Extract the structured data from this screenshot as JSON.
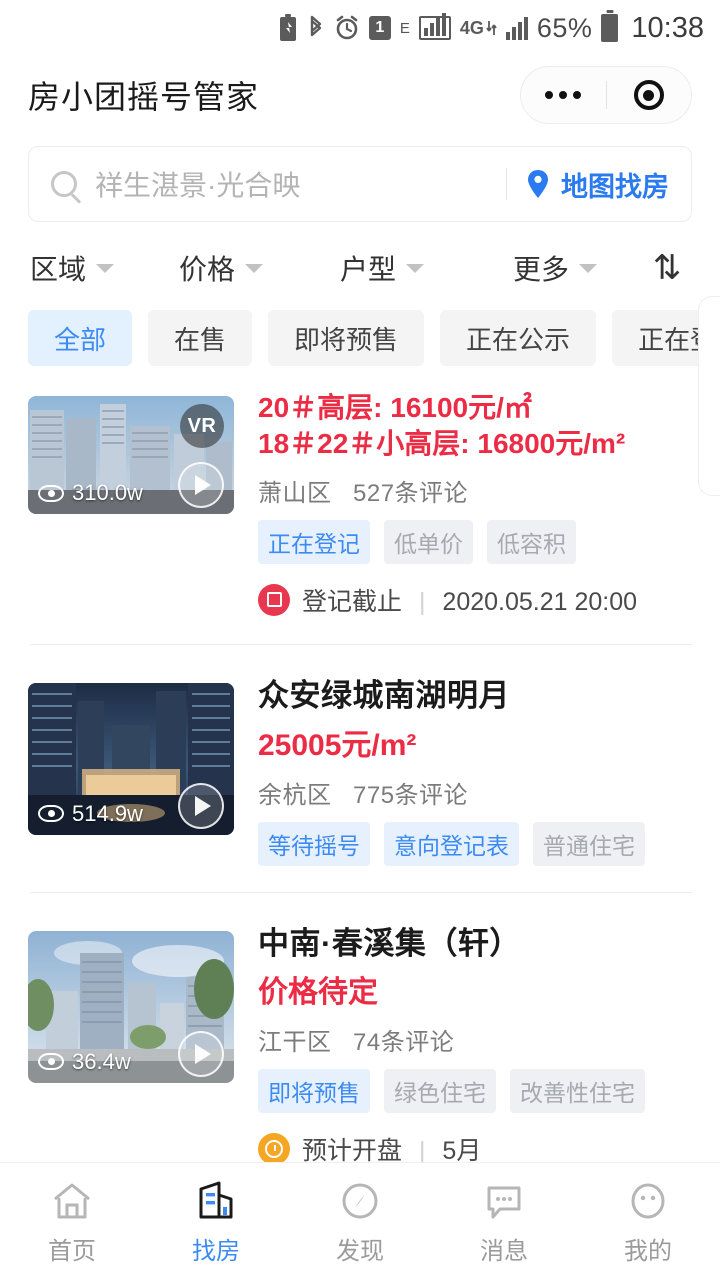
{
  "statusbar": {
    "icons": [
      "battery-saver-icon",
      "bluetooth-icon",
      "alarm-icon",
      "sim1-icon",
      "e-network-icon",
      "signal-boxed-icon",
      "4g-icon",
      "signal-icon"
    ],
    "e_label": "E",
    "sim_label": "1",
    "network_4g": "4G",
    "battery_percent": "65%",
    "clock": "10:38"
  },
  "header": {
    "title": "房小团摇号管家",
    "capsule": {
      "more_label": "•••",
      "target_label": ""
    }
  },
  "search": {
    "placeholder": "祥生湛景·光合映",
    "map_link": "地图找房"
  },
  "filters": [
    {
      "label": "区域"
    },
    {
      "label": "价格"
    },
    {
      "label": "户型"
    },
    {
      "label": "更多"
    }
  ],
  "sort": {
    "icon": "sort-updown-icon",
    "label": "⇅"
  },
  "chips": [
    {
      "label": "全部",
      "active": true
    },
    {
      "label": "在售",
      "active": false
    },
    {
      "label": "即将预售",
      "active": false
    },
    {
      "label": "正在公示",
      "active": false
    },
    {
      "label": "正在登记",
      "active": false
    }
  ],
  "listings": [
    {
      "name": "",
      "price_lines": [
        "20＃高层: 16100元/㎡",
        "18＃22＃小高层: 16800元/m²"
      ],
      "district": "萧山区",
      "comments": "527条评论",
      "tags": [
        {
          "label": "正在登记",
          "style": "blue"
        },
        {
          "label": "低单价",
          "style": "gray"
        },
        {
          "label": "低容积",
          "style": "gray"
        }
      ],
      "note": {
        "badge": "registration-deadline-icon",
        "badge_color": "#e8384f",
        "label": "登记截止",
        "value": "2020.05.21 20:00"
      },
      "views": "310.0w",
      "has_vr": true,
      "vr_label": "VR"
    },
    {
      "name": "众安绿城南湖明月",
      "price_lines": [
        "25005元/m²"
      ],
      "district": "余杭区",
      "comments": "775条评论",
      "tags": [
        {
          "label": "等待摇号",
          "style": "blue"
        },
        {
          "label": "意向登记表",
          "style": "blue"
        },
        {
          "label": "普通住宅",
          "style": "gray"
        }
      ],
      "note": null,
      "views": "514.9w",
      "has_vr": false,
      "vr_label": ""
    },
    {
      "name": "中南·春溪集（轩）",
      "price_lines": [
        "价格待定"
      ],
      "district": "江干区",
      "comments": "74条评论",
      "tags": [
        {
          "label": "即将预售",
          "style": "blue"
        },
        {
          "label": "绿色住宅",
          "style": "gray"
        },
        {
          "label": "改善性住宅",
          "style": "gray"
        }
      ],
      "note": {
        "badge": "expected-opening-icon",
        "badge_color": "#f5a623",
        "label": "预计开盘",
        "value": "5月"
      },
      "views": "36.4w",
      "has_vr": false,
      "vr_label": ""
    }
  ],
  "tabbar": [
    {
      "label": "首页",
      "icon": "home-icon",
      "active": false
    },
    {
      "label": "找房",
      "icon": "building-search-icon",
      "active": true
    },
    {
      "label": "发现",
      "icon": "compass-icon",
      "active": false
    },
    {
      "label": "消息",
      "icon": "chat-bubble-icon",
      "active": false
    },
    {
      "label": "我的",
      "icon": "profile-icon",
      "active": false
    }
  ],
  "colors": {
    "accent": "#3d8bf2",
    "price": "#ec2b45",
    "chip_active_bg": "#e3f0fd",
    "tag_blue_bg": "#e6f1fd",
    "tag_gray_bg": "#eef0f3"
  }
}
